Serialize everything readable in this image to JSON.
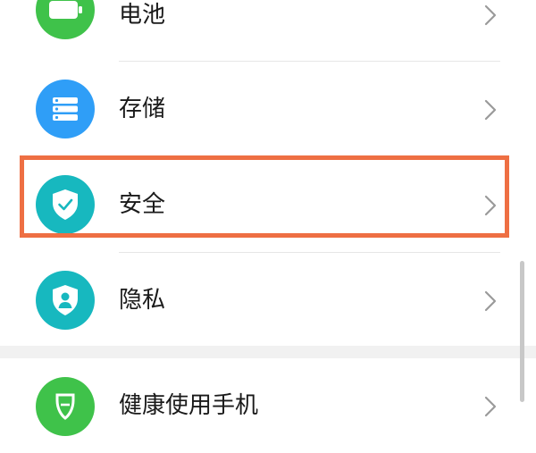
{
  "settings": {
    "items": [
      {
        "label": "电池",
        "icon": "battery-icon",
        "color": "#3fc24a"
      },
      {
        "label": "存储",
        "icon": "storage-icon",
        "color": "#2f9ef7"
      },
      {
        "label": "安全",
        "icon": "shield-check-icon",
        "color": "#17b8bf"
      },
      {
        "label": "隐私",
        "icon": "privacy-shield-icon",
        "color": "#17b8bf"
      },
      {
        "label": "健康使用手机",
        "icon": "health-icon",
        "color": "#3fc24a"
      }
    ]
  },
  "highlight": {
    "target": "安全",
    "color": "#ee6f43"
  }
}
